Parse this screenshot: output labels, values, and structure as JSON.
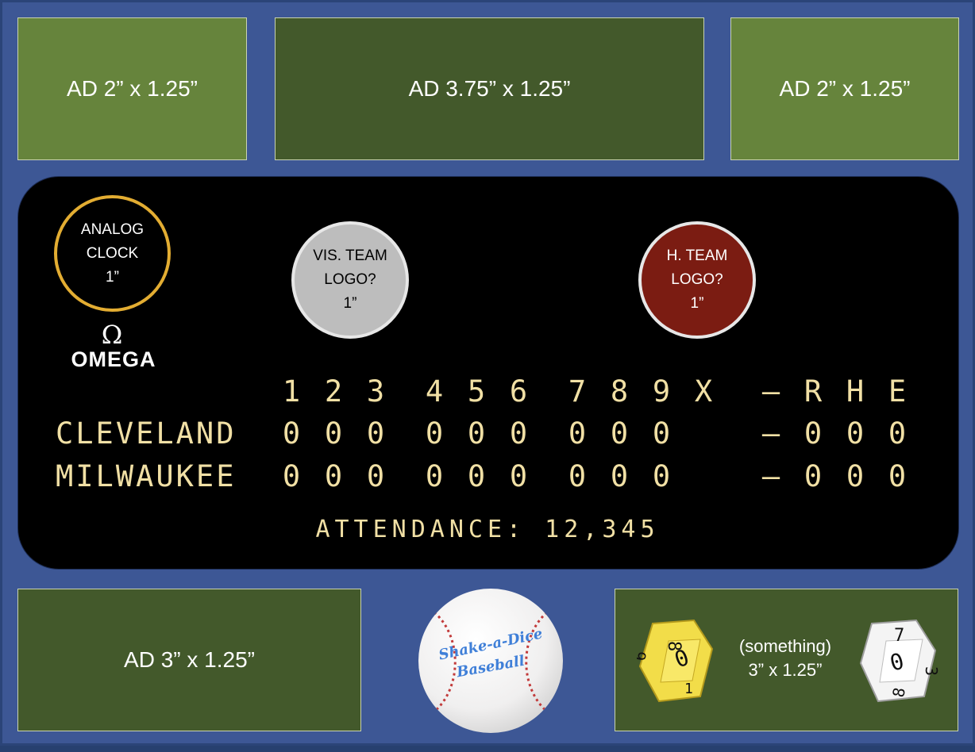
{
  "ads": {
    "top_left": "AD 2” x 1.25”",
    "top_center": "AD 3.75” x 1.25”",
    "top_right": "AD 2” x 1.25”",
    "bottom_left": "AD 3” x 1.25”"
  },
  "clock": {
    "line1": "ANALOG",
    "line2": "CLOCK",
    "line3": "1”"
  },
  "sponsor": {
    "symbol": "Ω",
    "name": "OMEGA"
  },
  "visitor_logo": {
    "line1": "VIS. TEAM",
    "line2": "LOGO?",
    "line3": "1”"
  },
  "home_logo": {
    "line1": "H. TEAM",
    "line2": "LOGO?",
    "line3": "1”"
  },
  "scoreboard": {
    "innings": [
      "1",
      "2",
      "3",
      "4",
      "5",
      "6",
      "7",
      "8",
      "9",
      "X"
    ],
    "dash": "—",
    "totals_labels": [
      "R",
      "H",
      "E"
    ],
    "teams": [
      {
        "name": "CLEVELAND",
        "innings": [
          "0",
          "0",
          "0",
          "0",
          "0",
          "0",
          "0",
          "0",
          "0",
          ""
        ],
        "totals": [
          "0",
          "0",
          "0"
        ]
      },
      {
        "name": "MILWAUKEE",
        "innings": [
          "0",
          "0",
          "0",
          "0",
          "0",
          "0",
          "0",
          "0",
          "0",
          ""
        ],
        "totals": [
          "0",
          "0",
          "0"
        ]
      }
    ],
    "attendance": "ATTENDANCE: 12,345"
  },
  "baseball": {
    "line1": "Shake-a-Dice",
    "line2": "Baseball"
  },
  "dice_panel": {
    "line1": "(something)",
    "line2": "3” x 1.25”"
  },
  "dice": [
    {
      "color": "#f2dd49",
      "numbers": [
        "8",
        "0",
        "6",
        "1"
      ]
    },
    {
      "color": "#f4f4f4",
      "numbers": [
        "7",
        "0",
        "3",
        "8"
      ]
    }
  ]
}
